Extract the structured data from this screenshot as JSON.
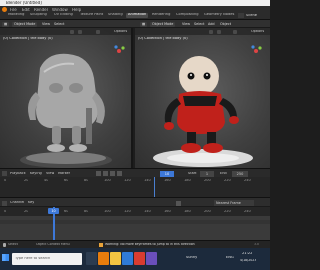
{
  "window": {
    "title": "Blender [Untitled]"
  },
  "menu": {
    "items": [
      "File",
      "Edit",
      "Render",
      "Window",
      "Help"
    ],
    "workspace_tabs": [
      "Modeling",
      "Sculpting",
      "UV Editing",
      "Texture Paint",
      "Shading",
      "Animation",
      "Rendering",
      "Compositing",
      "Geometry Nodes",
      "Scripting"
    ],
    "active_workspace": "Animation",
    "scene_label": "Scene"
  },
  "header": {
    "mode": "Object Mode",
    "view": "View",
    "select": "Select",
    "add": "Add",
    "object": "Object",
    "options": "Options"
  },
  "viewport_left": {
    "label": "(0) Collection | the body (0)",
    "options": "Options"
  },
  "viewport_right": {
    "label": "(0) Collection | the body (0)",
    "options": "Options"
  },
  "timeline": {
    "playback": "Playback",
    "keying": "Keying",
    "view": "View",
    "marker": "Marker",
    "start_label": "Start",
    "start": "1",
    "end_label": "End",
    "end": "250",
    "current": "10",
    "frames": [
      "0",
      "20",
      "40",
      "60",
      "80",
      "100",
      "120",
      "140",
      "160",
      "180",
      "200",
      "220",
      "240"
    ]
  },
  "dopesheet": {
    "mode": "Dope Sheet",
    "channel": "Channel",
    "key": "Key",
    "interpolation": "Nearest Frame",
    "current_frame": "10",
    "frames": [
      "0",
      "20",
      "40",
      "60",
      "80",
      "100",
      "120",
      "140",
      "160",
      "180",
      "200",
      "220",
      "240"
    ]
  },
  "status": {
    "left": "Select",
    "middle": "Object Context Menu",
    "right_msg": "Warning: No more keyframes to jump to in this direction",
    "version": "3.x"
  },
  "taskbar": {
    "search_placeholder": "Type here to search",
    "weather": "Sunny",
    "time": "21:22",
    "date": "4/18/2023",
    "lang": "ENG"
  },
  "colors": {
    "accent": "#3d78d8",
    "robot_red": "#c0211b",
    "taskbar": "#1c2a3c"
  }
}
